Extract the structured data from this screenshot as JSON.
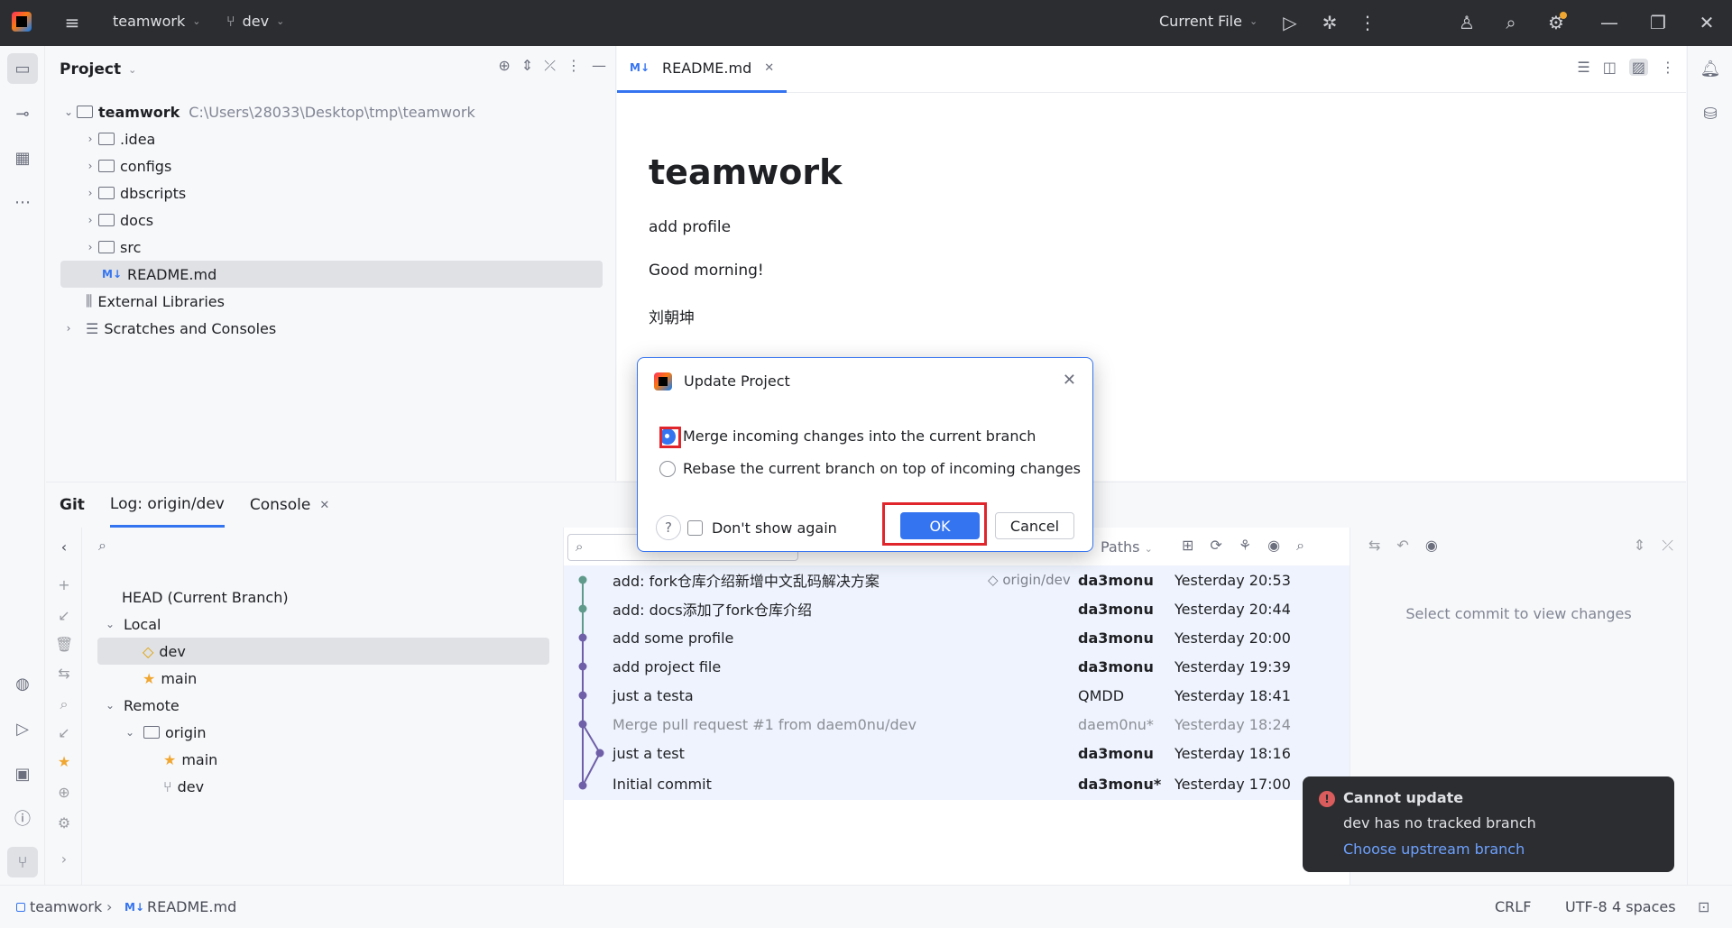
{
  "titlebar": {
    "project": "teamwork",
    "branch": "dev",
    "run_config": "Current File"
  },
  "project_panel": {
    "title": "Project",
    "root": {
      "name": "teamwork",
      "path": "C:\\Users\\28033\\Desktop\\tmp\\teamwork"
    },
    "items": [
      {
        "name": ".idea"
      },
      {
        "name": "configs"
      },
      {
        "name": "dbscripts"
      },
      {
        "name": "docs"
      },
      {
        "name": "src"
      },
      {
        "name": "README.md"
      }
    ],
    "external": "External Libraries",
    "scratches": "Scratches and Consoles"
  },
  "editor": {
    "tab": "README.md",
    "heading": "teamwork",
    "lines": [
      "add profile",
      "Good morning!",
      "刘朝坤"
    ]
  },
  "git": {
    "tabs": [
      "Git",
      "Log: origin/dev",
      "Console"
    ],
    "branches": {
      "head": "HEAD (Current Branch)",
      "local_label": "Local",
      "local": [
        "dev",
        "main"
      ],
      "remote_label": "Remote",
      "origin": "origin",
      "remote": [
        "main",
        "dev"
      ]
    },
    "log_filter": "Paths",
    "commits": [
      {
        "msg": "add: fork仓库介绍新增中文乱码解决方案",
        "ref": "origin/dev",
        "author": "da3monu",
        "date": "Yesterday 20:53"
      },
      {
        "msg": "add: docs添加了fork仓库介绍",
        "author": "da3monu",
        "date": "Yesterday 20:44"
      },
      {
        "msg": "add some profile",
        "author": "da3monu",
        "date": "Yesterday 20:00"
      },
      {
        "msg": "add project file",
        "author": "da3monu",
        "date": "Yesterday 19:39"
      },
      {
        "msg": "just a testa",
        "author": "QMDD",
        "date": "Yesterday 18:41"
      },
      {
        "msg": "Merge pull request #1 from daem0nu/dev",
        "author": "daem0nu*",
        "date": "Yesterday 18:24"
      },
      {
        "msg": "just a test",
        "author": "da3monu",
        "date": "Yesterday 18:16"
      },
      {
        "msg": "Initial commit",
        "author": "da3monu*",
        "date": "Yesterday 17:00"
      }
    ],
    "changes_placeholder": "Select commit to view changes"
  },
  "dialog": {
    "title": "Update Project",
    "option_merge": "Merge incoming changes into the current branch",
    "option_rebase": "Rebase the current branch on top of incoming changes",
    "dont_show": "Don't show again",
    "ok": "OK",
    "cancel": "Cancel",
    "help": "?"
  },
  "notification": {
    "title": "Cannot update",
    "body": "dev has no tracked branch",
    "link": "Choose upstream branch"
  },
  "statusbar": {
    "crumb_project": "teamwork",
    "crumb_file": "README.md",
    "line_sep": "CRLF",
    "encoding": "UTF-8",
    "indent": "4 spaces"
  },
  "colors": {
    "accent": "#3574f0",
    "highlight": "#e0262c",
    "titlebar": "#2b2d30"
  }
}
